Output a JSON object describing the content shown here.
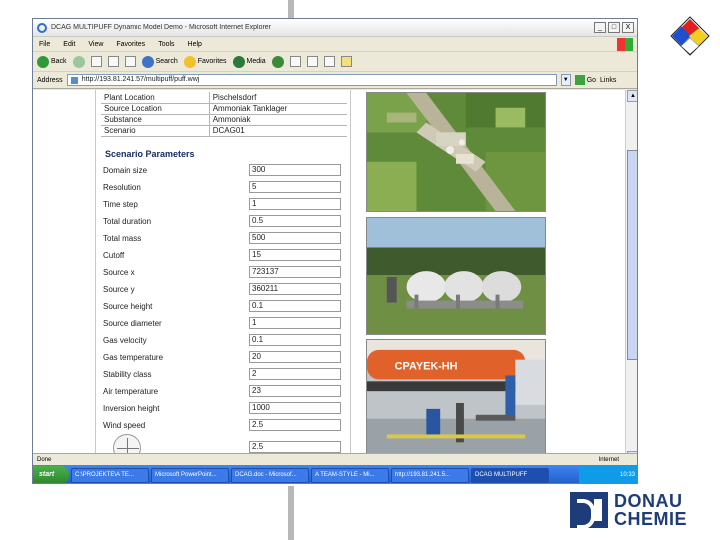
{
  "window": {
    "title": "DCAG MULTIPUFF Dynamic Model Demo - Microsoft Internet Explorer",
    "controls": [
      "_",
      "□",
      "X"
    ]
  },
  "menu": [
    "File",
    "Edit",
    "View",
    "Favorites",
    "Tools",
    "Help"
  ],
  "toolbar": {
    "back": "Back",
    "search": "Search",
    "favorites": "Favorites",
    "media": "Media"
  },
  "address": {
    "label": "Address",
    "url": "http://193.81.241.57/multipuff/puff.wwj",
    "go": "Go",
    "links": "Links"
  },
  "info_rows": [
    {
      "label": "Plant Location",
      "value": "Pischelsdorf"
    },
    {
      "label": "Source Location",
      "value": "Ammoniak Tanklager"
    },
    {
      "label": "Substance",
      "value": "Ammoniak"
    },
    {
      "label": "Scenario",
      "value": "DCAG01"
    }
  ],
  "scenario": {
    "title": "Scenario Parameters",
    "params": [
      {
        "label": "Domain size",
        "value": "300"
      },
      {
        "label": "Resolution",
        "value": "5"
      },
      {
        "label": "Time step",
        "value": "1"
      },
      {
        "label": "Total duration",
        "value": "0.5"
      },
      {
        "label": "Total mass",
        "value": "500"
      },
      {
        "label": "Cutoff",
        "value": "15"
      },
      {
        "label": "Source x",
        "value": "723137"
      },
      {
        "label": "Source y",
        "value": "360211"
      },
      {
        "label": "Source height",
        "value": "0.1"
      },
      {
        "label": "Source diameter",
        "value": "1"
      },
      {
        "label": "Gas velocity",
        "value": "0.1"
      },
      {
        "label": "Gas temperature",
        "value": "20"
      },
      {
        "label": "Stability class",
        "value": "2"
      },
      {
        "label": "Air temperature",
        "value": "23"
      },
      {
        "label": "Inversion height",
        "value": "1000"
      },
      {
        "label": "Wind speed",
        "value": "2.5"
      },
      {
        "label": "",
        "value": "2.5"
      }
    ]
  },
  "photos": {
    "tanker_text": "CPAYEK-HH"
  },
  "status": {
    "text": "Done",
    "zone": "Internet"
  },
  "taskbar": {
    "start": "start",
    "tasks": [
      "C:\\PROJEKTE\\A TE...",
      "Microsoft PowerPoint...",
      "DCAG.doc - Microsof...",
      "A TEAM-STYLE - Mi...",
      "http://193.81.241.5...",
      "DCAG MULTIPUFF"
    ],
    "clock": "10:33"
  },
  "logo": {
    "line1": "DONAU",
    "line2": "CHEMIE"
  }
}
